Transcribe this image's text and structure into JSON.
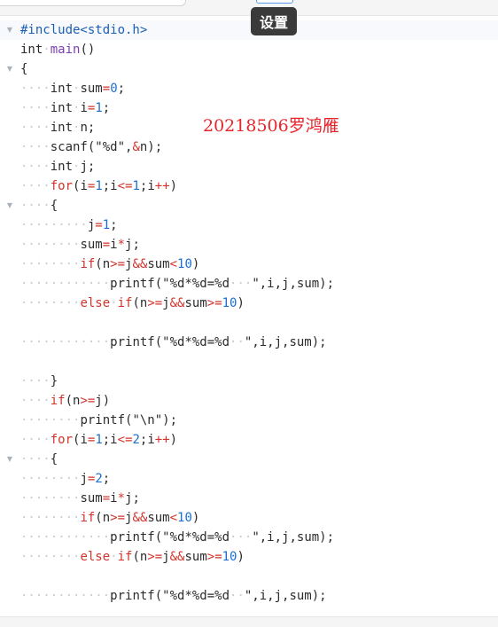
{
  "toolbar": {
    "tooltip": "设置"
  },
  "watermark": "20218506罗鸿雁",
  "colors": {
    "keyword": "#d0342c",
    "number": "#1a6fd1",
    "preprocessor": "#1a5fb4",
    "function": "#7a3fb4",
    "watermark": "#e8252b"
  },
  "code_lines": [
    {
      "fold": true,
      "active": true,
      "indent": 0,
      "tokens": [
        [
          "pp",
          "#include<stdio.h>"
        ]
      ]
    },
    {
      "fold": false,
      "indent": 0,
      "tokens": [
        [
          "t",
          "int"
        ],
        [
          "ws",
          "·"
        ],
        [
          "fn",
          "main"
        ],
        [
          "t",
          "()"
        ]
      ]
    },
    {
      "fold": true,
      "indent": 0,
      "tokens": [
        [
          "t",
          "{"
        ]
      ]
    },
    {
      "fold": false,
      "indent": 4,
      "tokens": [
        [
          "t",
          "int"
        ],
        [
          "ws",
          "·"
        ],
        [
          "t",
          "sum"
        ],
        [
          "op",
          "="
        ],
        [
          "num",
          "0"
        ],
        [
          "t",
          ";"
        ]
      ]
    },
    {
      "fold": false,
      "indent": 4,
      "tokens": [
        [
          "t",
          "int"
        ],
        [
          "ws",
          "·"
        ],
        [
          "t",
          "i"
        ],
        [
          "op",
          "="
        ],
        [
          "num",
          "1"
        ],
        [
          "t",
          ";"
        ]
      ]
    },
    {
      "fold": false,
      "indent": 4,
      "tokens": [
        [
          "t",
          "int"
        ],
        [
          "ws",
          "·"
        ],
        [
          "t",
          "n;"
        ]
      ]
    },
    {
      "fold": false,
      "indent": 4,
      "tokens": [
        [
          "t",
          "scanf(\"%d\","
        ],
        [
          "op",
          "&"
        ],
        [
          "t",
          "n);"
        ]
      ]
    },
    {
      "fold": false,
      "indent": 4,
      "tokens": [
        [
          "t",
          "int"
        ],
        [
          "ws",
          "·"
        ],
        [
          "t",
          "j;"
        ]
      ]
    },
    {
      "fold": false,
      "indent": 4,
      "tokens": [
        [
          "kw",
          "for"
        ],
        [
          "t",
          "(i"
        ],
        [
          "op",
          "="
        ],
        [
          "num",
          "1"
        ],
        [
          "t",
          ";i"
        ],
        [
          "op",
          "<="
        ],
        [
          "num",
          "1"
        ],
        [
          "t",
          ";i"
        ],
        [
          "op",
          "++"
        ],
        [
          "t",
          ")"
        ]
      ]
    },
    {
      "fold": true,
      "indent": 4,
      "tokens": [
        [
          "t",
          "{"
        ]
      ]
    },
    {
      "fold": false,
      "indent": 9,
      "tokens": [
        [
          "t",
          "j"
        ],
        [
          "op",
          "="
        ],
        [
          "num",
          "1"
        ],
        [
          "t",
          ";"
        ]
      ]
    },
    {
      "fold": false,
      "indent": 8,
      "tokens": [
        [
          "t",
          "sum"
        ],
        [
          "op",
          "="
        ],
        [
          "t",
          "i"
        ],
        [
          "op",
          "*"
        ],
        [
          "t",
          "j;"
        ]
      ]
    },
    {
      "fold": false,
      "indent": 8,
      "tokens": [
        [
          "kw",
          "if"
        ],
        [
          "t",
          "(n"
        ],
        [
          "op",
          ">="
        ],
        [
          "t",
          "j"
        ],
        [
          "op",
          "&&"
        ],
        [
          "t",
          "sum"
        ],
        [
          "op",
          "<"
        ],
        [
          "num",
          "10"
        ],
        [
          "t",
          ")"
        ]
      ]
    },
    {
      "fold": false,
      "indent": 12,
      "tokens": [
        [
          "t",
          "printf(\"%d*%d=%d"
        ],
        [
          "ws",
          "···"
        ],
        [
          "t",
          "\",i,j,sum);"
        ]
      ]
    },
    {
      "fold": false,
      "indent": 8,
      "tokens": [
        [
          "kw",
          "else"
        ],
        [
          "ws",
          "·"
        ],
        [
          "kw",
          "if"
        ],
        [
          "t",
          "(n"
        ],
        [
          "op",
          ">="
        ],
        [
          "t",
          "j"
        ],
        [
          "op",
          "&&"
        ],
        [
          "t",
          "sum"
        ],
        [
          "op",
          ">="
        ],
        [
          "num",
          "10"
        ],
        [
          "t",
          ")"
        ]
      ]
    },
    {
      "fold": false,
      "indent": 0,
      "tokens": []
    },
    {
      "fold": false,
      "indent": 12,
      "tokens": [
        [
          "t",
          "printf(\"%d*%d=%d"
        ],
        [
          "ws",
          "··"
        ],
        [
          "t",
          "\",i,j,sum);"
        ]
      ]
    },
    {
      "fold": false,
      "indent": 0,
      "tokens": []
    },
    {
      "fold": false,
      "indent": 4,
      "tokens": [
        [
          "t",
          "}"
        ]
      ]
    },
    {
      "fold": false,
      "indent": 4,
      "tokens": [
        [
          "kw",
          "if"
        ],
        [
          "t",
          "(n"
        ],
        [
          "op",
          ">="
        ],
        [
          "t",
          "j)"
        ]
      ]
    },
    {
      "fold": false,
      "indent": 8,
      "tokens": [
        [
          "t",
          "printf(\"\\n\");"
        ]
      ]
    },
    {
      "fold": false,
      "indent": 4,
      "tokens": [
        [
          "kw",
          "for"
        ],
        [
          "t",
          "(i"
        ],
        [
          "op",
          "="
        ],
        [
          "num",
          "1"
        ],
        [
          "t",
          ";i"
        ],
        [
          "op",
          "<="
        ],
        [
          "num",
          "2"
        ],
        [
          "t",
          ";i"
        ],
        [
          "op",
          "++"
        ],
        [
          "t",
          ")"
        ]
      ]
    },
    {
      "fold": true,
      "indent": 4,
      "tokens": [
        [
          "t",
          "{"
        ]
      ]
    },
    {
      "fold": false,
      "indent": 8,
      "tokens": [
        [
          "t",
          "j"
        ],
        [
          "op",
          "="
        ],
        [
          "num",
          "2"
        ],
        [
          "t",
          ";"
        ]
      ]
    },
    {
      "fold": false,
      "indent": 8,
      "tokens": [
        [
          "t",
          "sum"
        ],
        [
          "op",
          "="
        ],
        [
          "t",
          "i"
        ],
        [
          "op",
          "*"
        ],
        [
          "t",
          "j;"
        ]
      ]
    },
    {
      "fold": false,
      "indent": 8,
      "tokens": [
        [
          "kw",
          "if"
        ],
        [
          "t",
          "(n"
        ],
        [
          "op",
          ">="
        ],
        [
          "t",
          "j"
        ],
        [
          "op",
          "&&"
        ],
        [
          "t",
          "sum"
        ],
        [
          "op",
          "<"
        ],
        [
          "num",
          "10"
        ],
        [
          "t",
          ")"
        ]
      ]
    },
    {
      "fold": false,
      "indent": 12,
      "tokens": [
        [
          "t",
          "printf(\"%d*%d=%d"
        ],
        [
          "ws",
          "···"
        ],
        [
          "t",
          "\",i,j,sum);"
        ]
      ]
    },
    {
      "fold": false,
      "indent": 8,
      "tokens": [
        [
          "kw",
          "else"
        ],
        [
          "ws",
          "·"
        ],
        [
          "kw",
          "if"
        ],
        [
          "t",
          "(n"
        ],
        [
          "op",
          ">="
        ],
        [
          "t",
          "j"
        ],
        [
          "op",
          "&&"
        ],
        [
          "t",
          "sum"
        ],
        [
          "op",
          ">="
        ],
        [
          "num",
          "10"
        ],
        [
          "t",
          ")"
        ]
      ]
    },
    {
      "fold": false,
      "indent": 0,
      "tokens": []
    },
    {
      "fold": false,
      "indent": 12,
      "tokens": [
        [
          "t",
          "printf(\"%d*%d=%d"
        ],
        [
          "ws",
          "··"
        ],
        [
          "t",
          "\",i,j,sum);"
        ]
      ]
    }
  ]
}
